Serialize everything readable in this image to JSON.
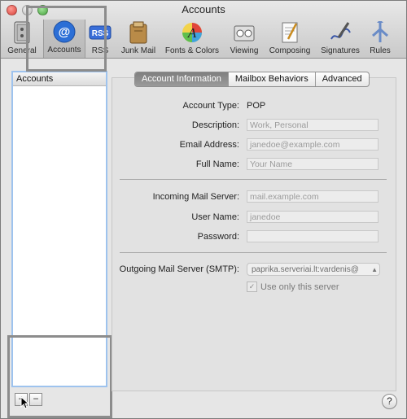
{
  "window": {
    "title": "Accounts"
  },
  "toolbar": {
    "items": [
      {
        "label": "General",
        "icon": "general-icon"
      },
      {
        "label": "Accounts",
        "icon": "at-sign-icon"
      },
      {
        "label": "RSS",
        "icon": "rss-icon"
      },
      {
        "label": "Junk Mail",
        "icon": "junk-mail-icon"
      },
      {
        "label": "Fonts & Colors",
        "icon": "fonts-colors-icon"
      },
      {
        "label": "Viewing",
        "icon": "viewing-icon"
      },
      {
        "label": "Composing",
        "icon": "composing-icon"
      },
      {
        "label": "Signatures",
        "icon": "signatures-icon"
      },
      {
        "label": "Rules",
        "icon": "rules-icon"
      }
    ],
    "selected": "Accounts"
  },
  "sidebar": {
    "header": "Accounts",
    "add_label": "+",
    "remove_label": "−"
  },
  "tabs": [
    {
      "label": "Account Information",
      "active": true
    },
    {
      "label": "Mailbox Behaviors",
      "active": false
    },
    {
      "label": "Advanced",
      "active": false
    }
  ],
  "form": {
    "account_type": {
      "label": "Account Type:",
      "value": "POP"
    },
    "description": {
      "label": "Description:",
      "placeholder": "Work, Personal"
    },
    "email": {
      "label": "Email Address:",
      "placeholder": "janedoe@example.com"
    },
    "full_name": {
      "label": "Full Name:",
      "placeholder": "Your Name"
    },
    "incoming_server": {
      "label": "Incoming Mail Server:",
      "placeholder": "mail.example.com"
    },
    "user_name": {
      "label": "User Name:",
      "placeholder": "janedoe"
    },
    "password": {
      "label": "Password:",
      "placeholder": ""
    },
    "outgoing_server": {
      "label": "Outgoing Mail Server (SMTP):",
      "value": "paprika.serveriai.lt:vardenis@"
    },
    "use_only_server": {
      "label": "Use only this server",
      "checked": true
    }
  },
  "help": {
    "label": "?"
  },
  "colors": {
    "accent": "#9ec3ee",
    "highlight_box": "#8c8c8c"
  }
}
